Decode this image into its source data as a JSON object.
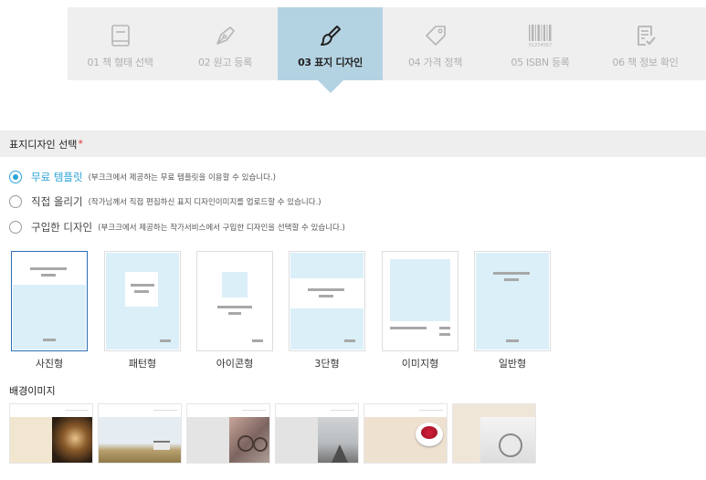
{
  "steps": [
    {
      "label": "01 책 형태 선택",
      "icon": "book-icon",
      "active": false
    },
    {
      "label": "02 원고 등록",
      "icon": "pen-nib-icon",
      "active": false
    },
    {
      "label": "03 표지 디자인",
      "icon": "paintbrush-icon",
      "active": true
    },
    {
      "label": "04 가격 정책",
      "icon": "price-tag-icon",
      "active": false
    },
    {
      "label": "05 ISBN 등록",
      "icon": "barcode-icon",
      "active": false
    },
    {
      "label": "06 책 정보 확인",
      "icon": "document-check-icon",
      "active": false
    }
  ],
  "barcode_number": "01234567",
  "section": {
    "title": "표지디자인 선택",
    "required_mark": "*"
  },
  "options": [
    {
      "label": "무료 템플릿",
      "desc": "(부크크에서 제공하는 무료 템플릿을 이용할 수 있습니다.)",
      "checked": true
    },
    {
      "label": "직접 올리기",
      "desc": "(작가님께서 직접 편집하신 표지 디자인이미지를 업로드할 수 있습니다.)",
      "checked": false
    },
    {
      "label": "구입한 디자인",
      "desc": "(부크크에서 제공하는 작가서비스에서 구입한 디자인을 선택할 수 있습니다.)",
      "checked": false
    }
  ],
  "templates": [
    {
      "label": "사진형",
      "selected": true
    },
    {
      "label": "패턴형",
      "selected": false
    },
    {
      "label": "아이콘형",
      "selected": false
    },
    {
      "label": "3단형",
      "selected": false
    },
    {
      "label": "이미지형",
      "selected": false
    },
    {
      "label": "일반형",
      "selected": false
    }
  ],
  "background_title": "배경이미지",
  "backgrounds": [
    {
      "name": "nebula-background"
    },
    {
      "name": "bench-field-background"
    },
    {
      "name": "bicycle-background"
    },
    {
      "name": "road-background"
    },
    {
      "name": "raspberry-bowl-background"
    },
    {
      "name": "clock-background"
    }
  ],
  "colors": {
    "accent": "#2aa3d6",
    "active_step": "#b4d3e2",
    "required": "#e03131",
    "template_blue": "#dbeff8"
  }
}
